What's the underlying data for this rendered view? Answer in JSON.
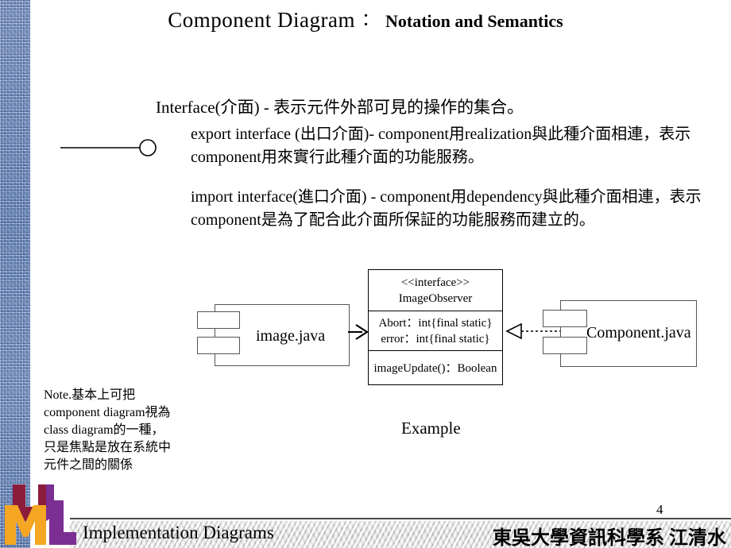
{
  "slide": {
    "title": {
      "main": "Component Diagram",
      "colon": "：",
      "sub": "Notation and Semantics"
    },
    "intro_line": "Interface(介面) - 表示元件外部可見的操作的集合。",
    "paragraph_export": "export interface (出口介面)- component用realization與此種介面相連，表示component用來實行此種介面的功能服務。",
    "paragraph_import": "import interface(進口介面) - component用dependency與此種介面相連，表示component是為了配合此介面所保証的功能服務而建立的。",
    "note": {
      "lines": [
        "Note.基本上可把",
        "component diagram視為",
        "class diagram的一種，",
        "只是焦點是放在系統中",
        "元件之間的關係"
      ]
    },
    "example_label": "Example"
  },
  "diagram": {
    "component_left": {
      "label": "image.java"
    },
    "component_right": {
      "label": "Component.java"
    },
    "interface_class": {
      "stereotype": "<<interface>>",
      "name": "ImageObserver",
      "attributes": [
        "Abort：int{final static}",
        "error：int{final static}"
      ],
      "operations": [
        "imageUpdate()：Boolean"
      ]
    },
    "connector_dependency": "dependency-arrow",
    "connector_realization": "realization-arrow"
  },
  "footer": {
    "left_text": "Implementation Diagrams",
    "right_text": "東吳大學資訊科學系 江清水",
    "page_number": "4"
  },
  "colors": {
    "sidebar_blue": "#6f8fc4",
    "logo_u_red": "#8c1c3c",
    "logo_m_orange": "#f5a623",
    "logo_l_purple": "#7b2f93",
    "footer_bar_gray": "#d8d8d8"
  }
}
